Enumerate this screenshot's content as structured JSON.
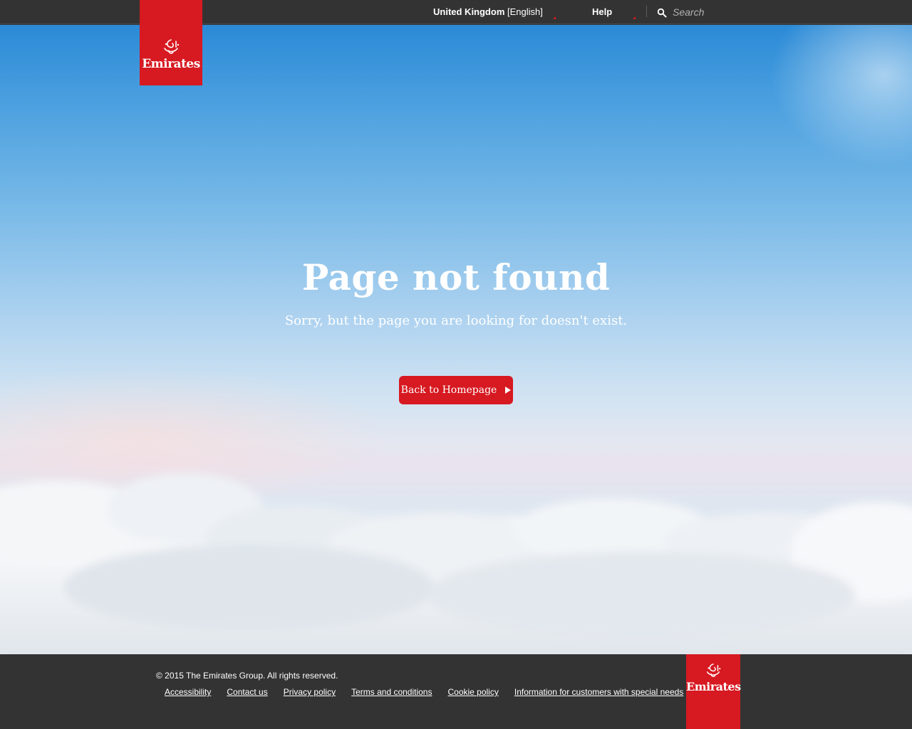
{
  "topbar": {
    "country_name": "United Kingdom",
    "country_language": "[English]",
    "help_label": "Help",
    "search_placeholder": "Search"
  },
  "brand": {
    "logo_text": "Emirates",
    "brand_color": "#d71921"
  },
  "main": {
    "title": "Page not found",
    "subtitle": "Sorry, but the page you are looking for doesn't exist.",
    "back_button_label": "Back to Homepage",
    "back_button_icon": "play-triangle-icon"
  },
  "footer": {
    "copyright": "© 2015 The Emirates Group. All rights reserved.",
    "links": [
      "Accessibility",
      "Contact us",
      "Privacy policy",
      "Terms and conditions",
      "Cookie policy",
      "Information for customers with special needs"
    ]
  },
  "colors": {
    "topbar_bg": "#333333",
    "sky_top": "#2b8ad6",
    "sky_horizon": "#e9e3ee"
  }
}
